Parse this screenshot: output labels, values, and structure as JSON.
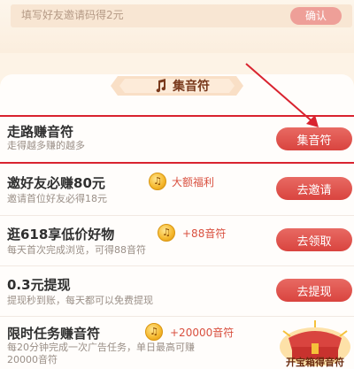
{
  "invite": {
    "placeholder": "填写好友邀请码得2元",
    "confirm_label": "确认"
  },
  "section": {
    "title": "集音符",
    "icon": "music-note-icon"
  },
  "tasks": [
    {
      "title": "走路赚音符",
      "desc": "走得越多赚的越多",
      "button": "集音符"
    },
    {
      "title": "邀好友必赚80元",
      "desc": "邀请首位好友必得18元",
      "reward": "大额福利",
      "button": "去邀请"
    },
    {
      "title": "逛618享低价好物",
      "desc": "每天首次完成浏览，可得88音符",
      "reward": "+88音符",
      "button": "去领取"
    },
    {
      "title": "0.3元提现",
      "desc": "提现秒到账，每天都可以免费提现",
      "button": "去提现"
    },
    {
      "title": "限时任务赚音符",
      "desc_line1": "每20分钟完成一次广告任务，单日最高可赚",
      "desc_line2": "20000音符",
      "reward": "+20000音符"
    }
  ],
  "chest": {
    "label": "开宝箱得音符"
  },
  "colors": {
    "accent": "#d9443f",
    "highlight": "#d9232f",
    "background": "#fdf3e6"
  }
}
